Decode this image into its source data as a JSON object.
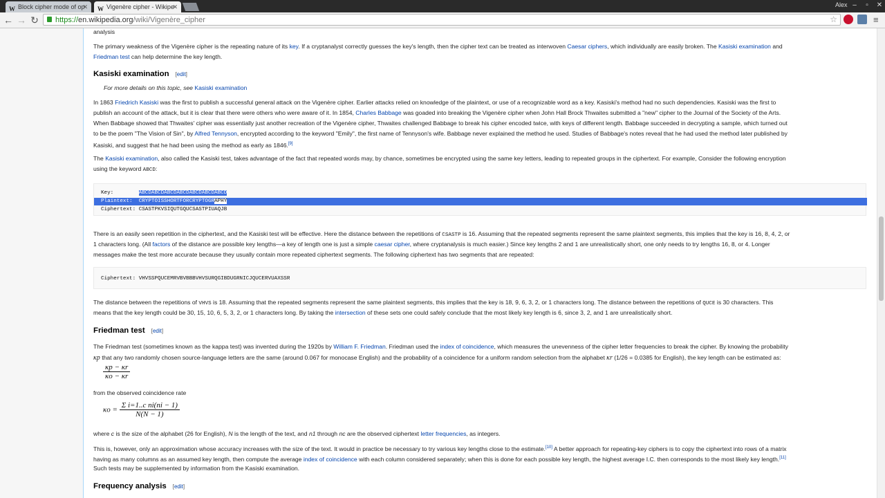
{
  "browser": {
    "tabs": [
      {
        "title": "Block cipher mode of op",
        "favicon": "W"
      },
      {
        "title": "Vigenère cipher - Wikipe",
        "favicon": "W"
      }
    ],
    "user": "Alex",
    "url": {
      "scheme": "https://",
      "host": "en.wikipedia.org",
      "path": "/wiki/Vigenère_cipher"
    }
  },
  "article": {
    "p_top_fragment": "analysis",
    "p_weakness": {
      "a": "The primary weakness of the Vigenère cipher is the repeating nature of its ",
      "link_key": "key",
      "b": ". If a cryptanalyst correctly guesses the key's length, then the cipher text can be treated as interwoven ",
      "link_caesar": "Caesar ciphers",
      "c": ", which individually are easily broken. The ",
      "link_kasiski": "Kasiski examination",
      "d": " and",
      "link_friedman": "Friedman test",
      "e": " can help determine the key length."
    },
    "h_kasiski": "Kasiski examination",
    "edit_label": "edit",
    "hatnote": {
      "a": "For more details on this topic, see ",
      "link": "Kasiski examination"
    },
    "k1": {
      "l1a": "In 1863 ",
      "l1link": "Friedrich Kasiski",
      "l1b": " was the first to publish a successful general attack on the Vigenère cipher. Earlier attacks relied on knowledge of the plaintext, or use of a recognizable word as a key. Kasiski's method had no such dependencies. Kasiski was the first to",
      "l2a": "publish an account of the attack, but it is clear that there were others who were aware of it. In 1854, ",
      "l2link": "Charles Babbage",
      "l2b": " was goaded into breaking the Vigenère cipher when John Hall Brock Thwaites submitted a \"new\" cipher to the Journal of the Society of the Arts.",
      "l3": "When Babbage showed that Thwaites' cipher was essentially just another recreation of the Vigenère cipher, Thwaites challenged Babbage to break his cipher encoded twice, with keys of different length. Babbage succeeded in decrypting a sample, which turned out",
      "l4a": "to be the poem \"The Vision of Sin\", by ",
      "l4link": "Alfred Tennyson",
      "l4b": ", encrypted according to the keyword \"Emily\", the first name of Tennyson's wife. Babbage never explained the method he used. Studies of Babbage's notes reveal that he had used the method later published by",
      "l5": "Kasiski, and suggest that he had been using the method as early as 1846.",
      "l5ref": "[9]"
    },
    "k2": {
      "a": "The ",
      "link": "Kasiski examination",
      "b": ", also called the Kasiski test, takes advantage of the fact that repeated words may, by chance, sometimes be encrypted using the same key letters, leading to repeated groups in the ciphertext. For example, Consider the following encryption",
      "l2": "using the keyword ",
      "code": "ABCD",
      "l2end": ":"
    },
    "pre1": {
      "key_label": "Key:        ",
      "key_value": "ABCDABCDABCDABCDABCDABCDABCD",
      "plain_label": "Plaintext:  ",
      "plain_sel": "CRYPTOISSHORTFORCRYPTOGR",
      "plain_rest": "APHY",
      "cipher_label": "Ciphertext: ",
      "cipher_value": "CSASTPKVSIQUTGQUCSASTPIUAQJB"
    },
    "k3": {
      "l1a": "There is an easily seen repetition in the ciphertext, and the Kasiski test will be effective. Here the distance between the repetitions of ",
      "l1code": "CSASTP",
      "l1b": " is 16. Assuming that the repeated segments represent the same plaintext segments, this implies that the key is 16, 8, 4, 2, or",
      "l2a": "1 characters long. (All ",
      "l2link1": "factors",
      "l2b": " of the distance are possible key lengths—a key of length one is just a simple ",
      "l2link2": "caesar cipher",
      "l2c": ", where cryptanalysis is much easier.) Since key lengths 2 and 1 are unrealistically short, one only needs to try lengths 16, 8, or 4. Longer",
      "l3": "messages make the test more accurate because they usually contain more repeated ciphertext segments. The following ciphertext has two segments that are repeated:"
    },
    "pre2": {
      "label": "Ciphertext: ",
      "value": "VHVSSPQUCEMRVBVBBBVHVSURQGIBDUGRNICJQUCERVUAXSSR"
    },
    "k4": {
      "l1a": "The distance between the repetitions of ",
      "l1code1": "VHVS",
      "l1b": " is 18. Assuming that the repeated segments represent the same plaintext segments, this implies that the key is 18, 9, 6, 3, 2, or 1 characters long. The distance between the repetitions of ",
      "l1code2": "QUCE",
      "l1c": " is 30 characters. This",
      "l2a": "means that the key length could be 30, 15, 10, 6, 5, 3, 2, or 1 characters long. By taking the ",
      "l2link": "intersection",
      "l2b": " of these sets one could safely conclude that the most likely key length is 6, since 3, 2, and 1 are unrealistically short."
    },
    "h_friedman": "Friedman test",
    "f1": {
      "l1a": "The Friedman test (sometimes known as the kappa test) was invented during the 1920s by ",
      "l1link1": "William F. Friedman",
      "l1b": ". Friedman used the ",
      "l1link2": "index of coincidence",
      "l1c": ", which measures the unevenness of the cipher letter frequencies to break the cipher. By knowing the probability",
      "l2sym": "κp",
      "l2a": " that any two randomly chosen source-language letters are the same (around 0.067 for monocase English) and the probability of a coincidence for a uniform random selection from the alphabet ",
      "l2sym2": "κr",
      "l2b": " (1/26 = 0.0385 for English), the key length can be estimated as:"
    },
    "formula1": {
      "num": "κp − κr",
      "den": "κo − κr"
    },
    "f2": "from the observed coincidence rate",
    "formula2": {
      "lhs": "κo =",
      "num": "Σ i=1..c  ni(ni − 1)",
      "den": "N(N − 1)"
    },
    "f3": {
      "a": "where ",
      "c": "c",
      "b": " is the size of the alphabet (26 for English), ",
      "n": "N",
      "d": " is the length of the text, and ",
      "n1": "n1",
      "e": " through ",
      "nc": "nc",
      "f": " are the observed ciphertext ",
      "link": "letter frequencies",
      "g": ", as integers."
    },
    "f4": {
      "l1a": "This is, however, only an approximation whose accuracy increases with the size of the text. It would in practice be necessary to try various key lengths close to the estimate.",
      "l1ref": "[10]",
      "l1b": " A better approach for repeating-key ciphers is to copy the ciphertext into rows of a matrix",
      "l2a": "having as many columns as an assumed key length, then compute the average ",
      "l2link": "index of coincidence",
      "l2b": " with each column considered separately; when this is done for each possible key length, the highest average I.C. then corresponds to the most likely key length.",
      "l2ref": "[11]",
      "l3": "Such tests may be supplemented by information from the Kasiski examination."
    },
    "h_frequency": "Frequency analysis"
  }
}
